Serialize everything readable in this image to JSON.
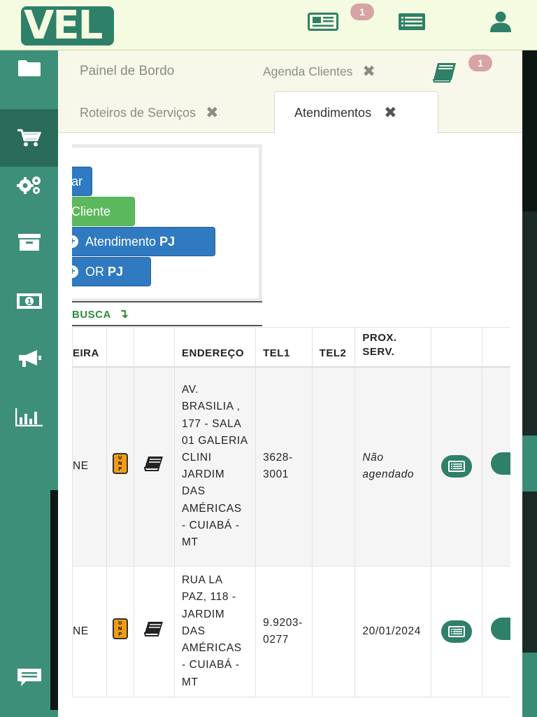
{
  "app": {
    "logo_text": "VEL",
    "colors": {
      "brand": "#2e8068",
      "sidebar": "#3d8f79",
      "badge": "#d8a3a3",
      "primary_button": "#2f7ac1",
      "success_button": "#5cb85c"
    }
  },
  "topbar": {
    "icons": [
      "newspaper-icon",
      "list-card-icon",
      "user-icon"
    ],
    "news_badge": "1"
  },
  "sidebar": {
    "items": [
      "folder-icon",
      "cart-icon",
      "gears-icon",
      "archive-icon",
      "money-icon",
      "megaphone-icon",
      "bar-chart-icon"
    ],
    "active_index": 1,
    "chat_icon": "chat-icon"
  },
  "tabs": {
    "items": [
      {
        "label": "Painel de Bordo",
        "closable": false
      },
      {
        "label": "Agenda Clientes",
        "closable": true
      },
      {
        "label": "Roteiros de Serviços",
        "closable": true
      },
      {
        "label": "Atendimentos",
        "closable": true,
        "active": true
      }
    ],
    "book_badge": "1",
    "close_glyph": "✖"
  },
  "actions": {
    "btn1": "ar",
    "btn2": "Cliente",
    "btn3": "Atendimento",
    "btn3_bold": "PJ",
    "btn4": "OR",
    "btn4_bold": "PJ"
  },
  "busca": {
    "label": "BUSCA",
    "arrow": "↴"
  },
  "table": {
    "headers": [
      "EIRA",
      "",
      "",
      "ENDEREÇO",
      "TEL1",
      "TEL2",
      "PROX. SERV.",
      "",
      ""
    ],
    "rows": [
      {
        "col1": "NE",
        "badge": "UNP",
        "address": "AV. BRASILIA , 177 - SALA 01 GALERIA CLINI JARDIM DAS AMÉRICAS - CUIABÁ - MT",
        "tel1": "3628-3001",
        "tel2": "",
        "prox": "Não agendado"
      },
      {
        "col1": "NE",
        "badge": "UNP",
        "address": "RUA LA PAZ, 118 - JARDIM DAS AMÉRICAS - CUIABÁ - MT",
        "tel1": "9.9203-0277",
        "tel2": "",
        "prox": "20/01/2024"
      }
    ]
  }
}
